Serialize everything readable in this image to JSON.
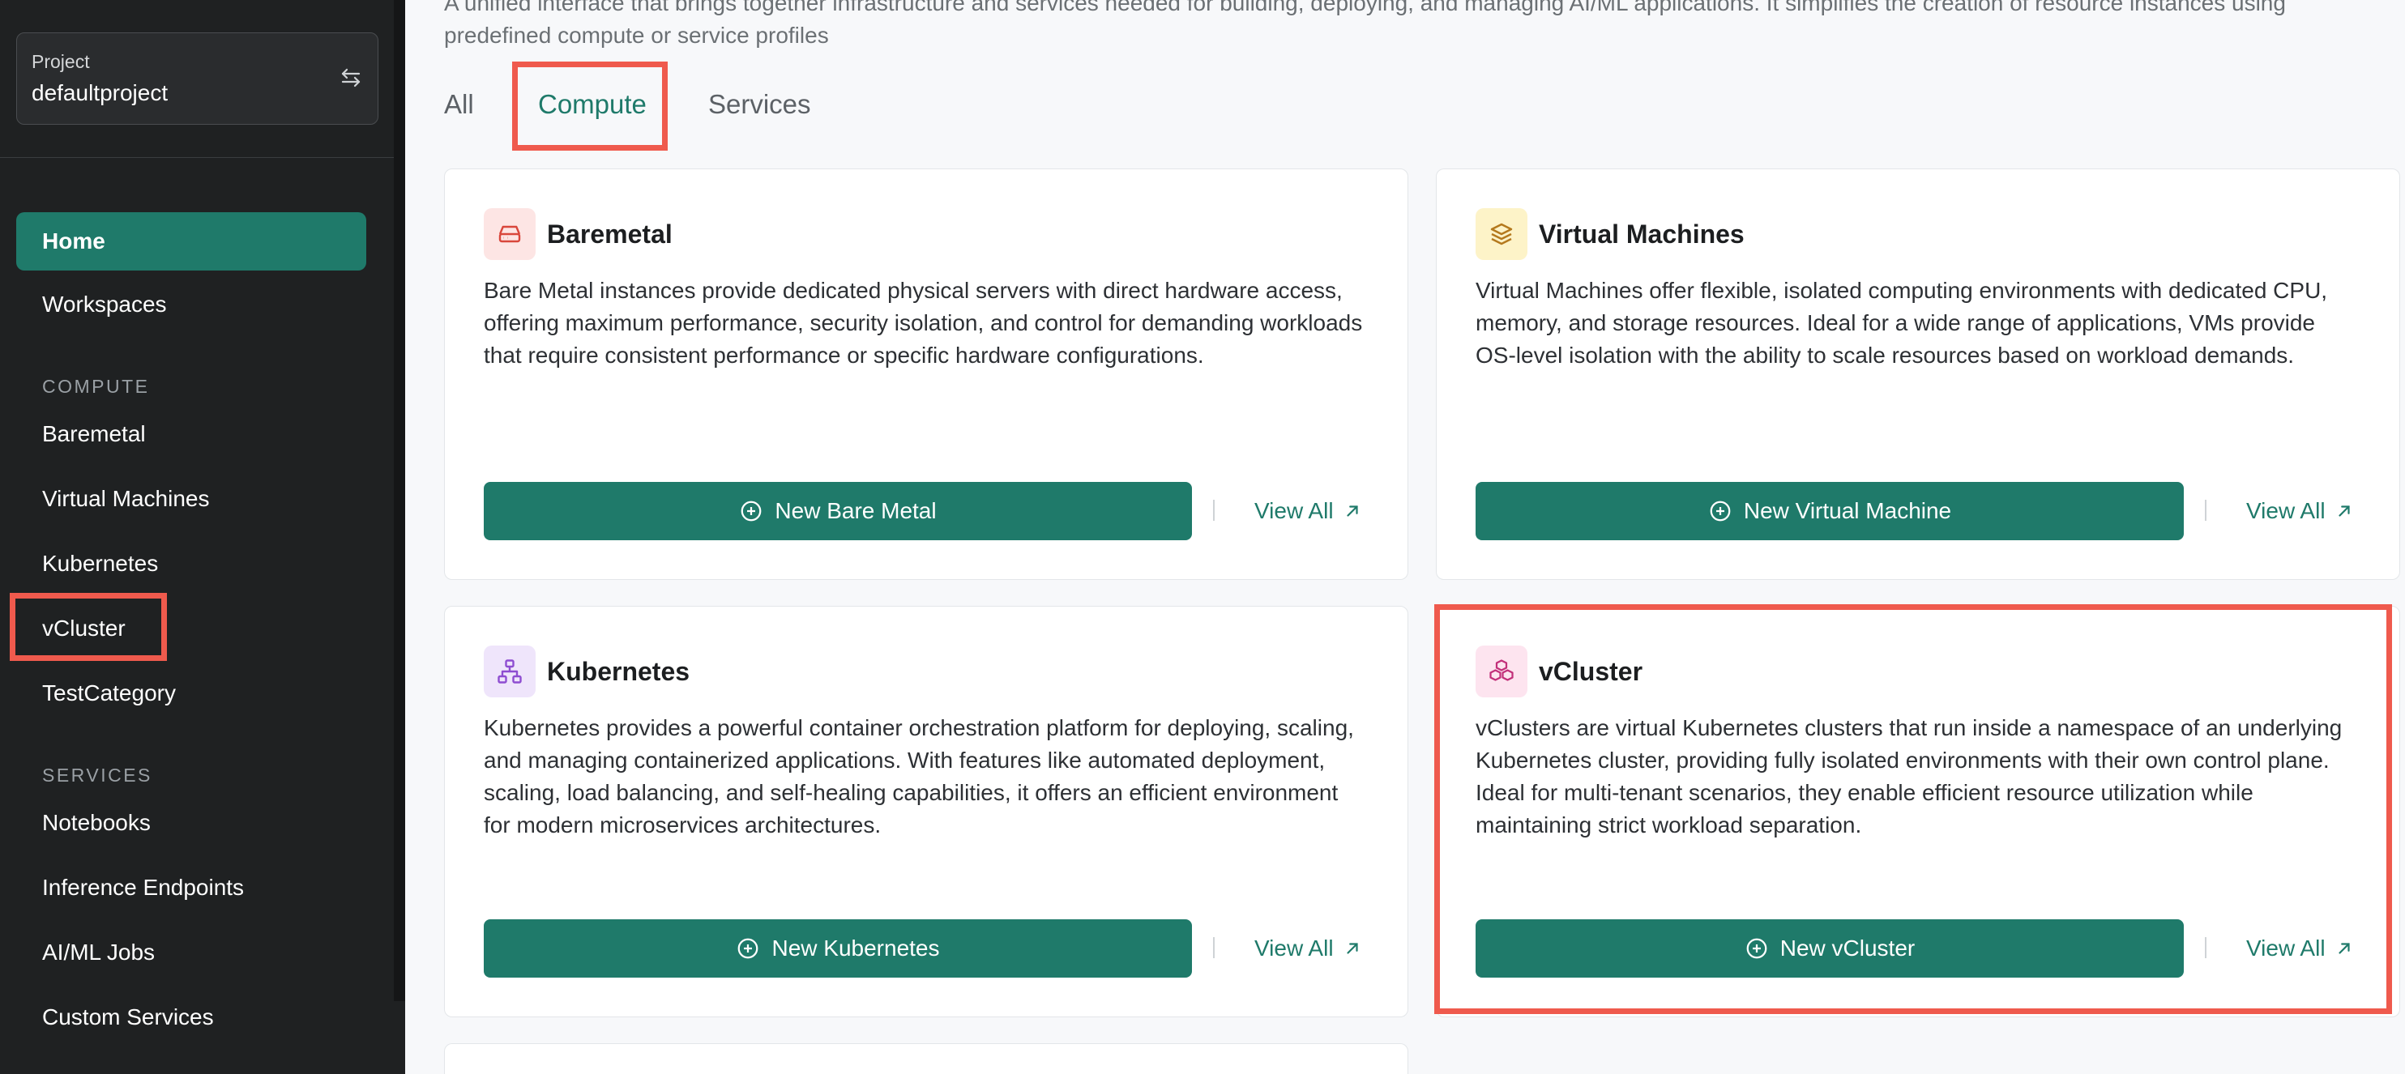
{
  "sidebar": {
    "project": {
      "label": "Project",
      "value": "defaultproject"
    },
    "items": [
      {
        "label": "Home"
      },
      {
        "label": "Workspaces"
      }
    ],
    "compute_section": "COMPUTE",
    "compute_items": [
      {
        "label": "Baremetal"
      },
      {
        "label": "Virtual Machines"
      },
      {
        "label": "Kubernetes"
      },
      {
        "label": "vCluster"
      },
      {
        "label": "TestCategory"
      }
    ],
    "services_section": "SERVICES",
    "services_items": [
      {
        "label": "Notebooks"
      },
      {
        "label": "Inference Endpoints"
      },
      {
        "label": "AI/ML Jobs"
      },
      {
        "label": "Custom Services"
      }
    ]
  },
  "main": {
    "intro": "A unified interface that brings together infrastructure and services needed for building, deploying, and managing AI/ML applications. It simplifies the creation of resource instances using predefined compute or service profiles",
    "tabs": [
      {
        "label": "All"
      },
      {
        "label": "Compute"
      },
      {
        "label": "Services"
      }
    ],
    "cards": [
      {
        "title": "Baremetal",
        "description": "Bare Metal instances provide dedicated physical servers with direct hardware access, offering maximum performance, security isolation, and control for demanding workloads that require consistent performance or specific hardware configurations.",
        "button": "New Bare Metal",
        "view_all": "View All",
        "icon": "server-icon"
      },
      {
        "title": "Virtual Machines",
        "description": "Virtual Machines offer flexible, isolated computing environments with dedicated CPU, memory, and storage resources. Ideal for a wide range of applications, VMs provide OS-level isolation with the ability to scale resources based on workload demands.",
        "button": "New Virtual Machine",
        "view_all": "View All",
        "icon": "layers-icon"
      },
      {
        "title": "Kubernetes",
        "description": "Kubernetes provides a powerful container orchestration platform for deploying, scaling, and managing containerized applications. With features like automated deployment, scaling, load balancing, and self-healing capabilities, it offers an efficient environment for modern microservices architectures.",
        "button": "New Kubernetes",
        "view_all": "View All",
        "icon": "network-icon"
      },
      {
        "title": "vCluster",
        "description": "vClusters are virtual Kubernetes clusters that run inside a namespace of an underlying Kubernetes cluster, providing fully isolated environments with their own control plane. Ideal for multi-tenant scenarios, they enable efficient resource utilization while maintaining strict workload separation.",
        "button": "New vCluster",
        "view_all": "View All",
        "icon": "boxes-icon"
      }
    ]
  },
  "colors": {
    "accent": "#1f7a6a",
    "sidebar_bg": "#1f2122",
    "highlight": "#ef5a4d"
  }
}
